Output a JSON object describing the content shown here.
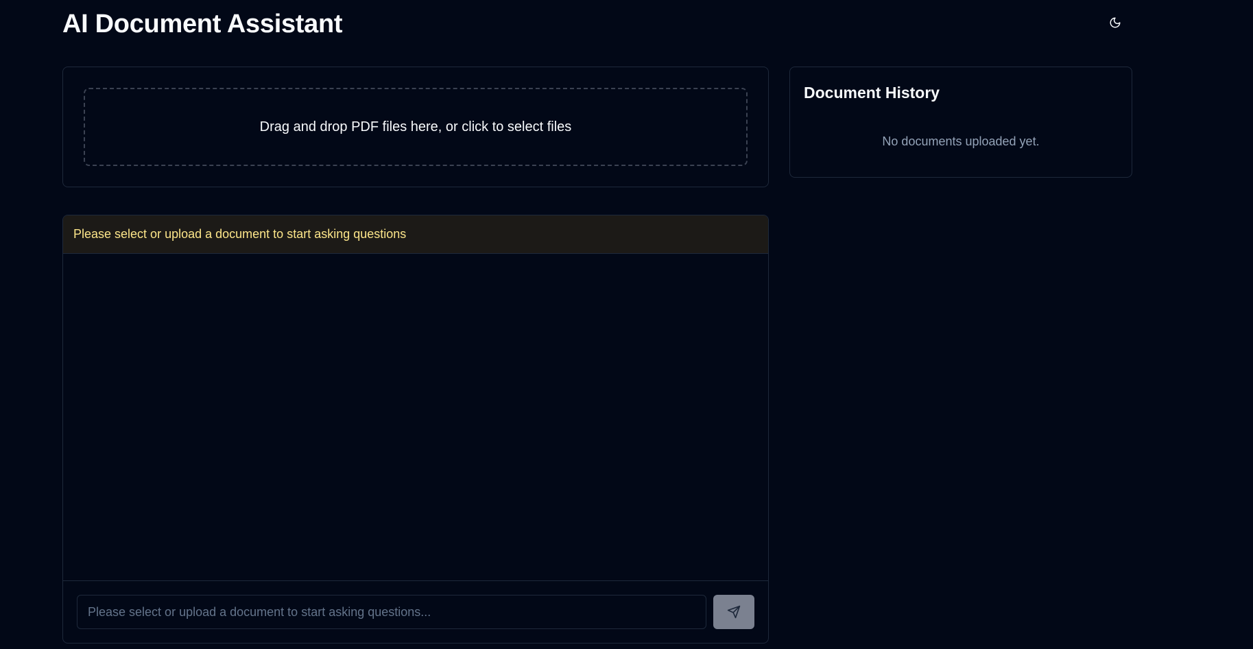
{
  "header": {
    "title": "AI Document Assistant",
    "theme_toggle_icon": "moon-icon"
  },
  "upload": {
    "dropzone_text": "Drag and drop PDF files here, or click to select files"
  },
  "history": {
    "title": "Document History",
    "empty_text": "No documents uploaded yet."
  },
  "chat": {
    "banner_text": "Please select or upload a document to start asking questions",
    "input_placeholder": "Please select or upload a document to start asking questions...",
    "input_value": "",
    "send_icon": "send-icon",
    "send_disabled": true
  },
  "colors": {
    "background": "#020817",
    "border": "#1e293b",
    "banner_background": "#1c1a17",
    "banner_text": "#fde68a",
    "muted_text": "#94a3b8",
    "send_button_disabled": "#7b8190"
  }
}
